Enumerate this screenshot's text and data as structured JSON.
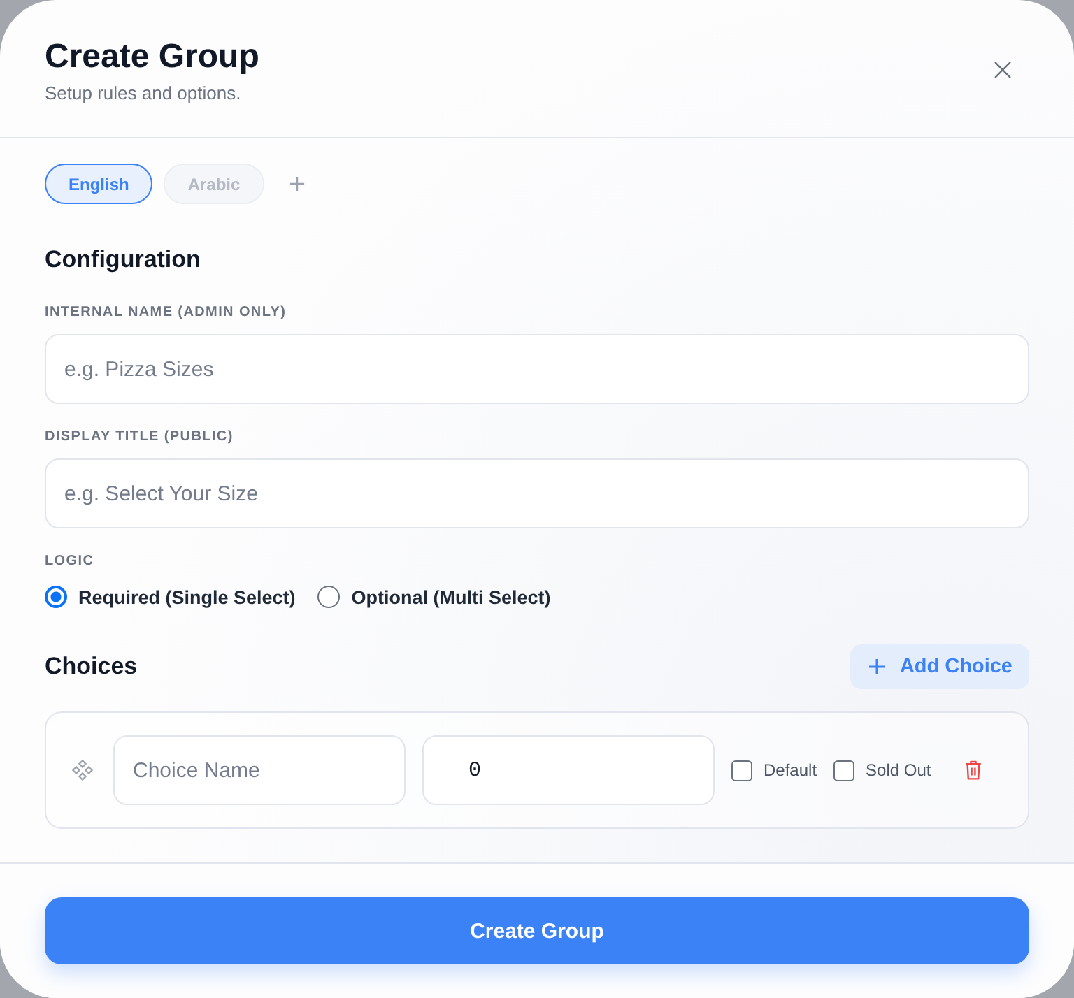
{
  "dialog": {
    "title": "Create Group",
    "subtitle": "Setup rules and options."
  },
  "language_tabs": [
    {
      "label": "English",
      "selected": true
    },
    {
      "label": "Arabic",
      "selected": false
    }
  ],
  "configuration": {
    "heading": "Configuration",
    "fields": [
      {
        "label": "INTERNAL NAME (ADMIN ONLY)",
        "placeholder": "e.g. Pizza Sizes"
      },
      {
        "label": "DISPLAY TITLE (PUBLIC)",
        "placeholder": "e.g. Select Your Size"
      }
    ],
    "logic": {
      "label": "LOGIC",
      "options": [
        {
          "label": "Required (Single Select)",
          "selected": true
        },
        {
          "label": "Optional (Multi Select)",
          "selected": false
        }
      ]
    }
  },
  "choices": {
    "heading": "Choices",
    "add_button": "Add Choice",
    "items": [
      {
        "name_placeholder": "Choice Name",
        "price": "0",
        "options": [
          {
            "label": "Default",
            "checked": false
          },
          {
            "label": "Sold Out",
            "checked": false
          }
        ]
      }
    ]
  },
  "submit_button": "Create Group"
}
